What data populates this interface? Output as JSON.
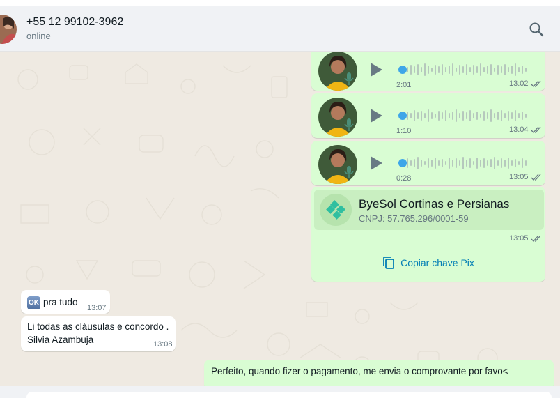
{
  "header": {
    "contact_name": "+55 12 99102-3962",
    "status": "online",
    "search_icon": "search-icon"
  },
  "messages": {
    "voice1": {
      "duration": "2:01",
      "time": "13:02"
    },
    "voice2": {
      "duration": "1:10",
      "time": "13:04"
    },
    "voice3": {
      "duration": "0:28",
      "time": "13:05"
    },
    "pix": {
      "name": "ByeSol Cortinas e Persianas",
      "cnpj": "CNPJ: 57.765.296/0001-59",
      "time": "13:05",
      "copy_label": "Copiar chave Pix"
    },
    "in1": {
      "badge": "OK",
      "text": "pra tudo",
      "time": "13:07"
    },
    "in2": {
      "line1": "Li todas as cláusulas e concordo .",
      "line2": "Silvia Azambuja",
      "time": "13:08"
    },
    "out_last": {
      "text": "Perfeito, quando fizer o pagamento, me envia o comprovante por favo<"
    }
  },
  "colors": {
    "outgoing_bubble": "#d9fdd3",
    "incoming_bubble": "#ffffff",
    "chat_background": "#efeae2",
    "read_ticks": "#667781",
    "link": "#027eb5",
    "pix_accent": "#2fbfa0"
  }
}
